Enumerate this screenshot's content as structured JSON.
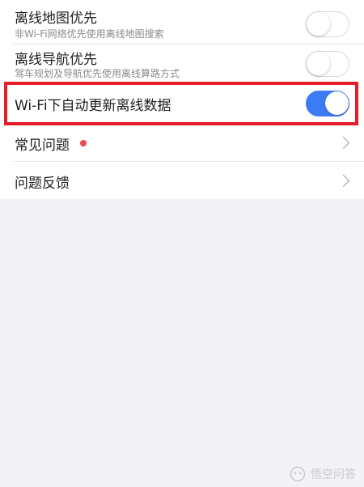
{
  "settings": {
    "offline_map": {
      "title": "离线地图优先",
      "subtitle": "非Wi-Fi网络优先使用离线地图搜索",
      "enabled": false
    },
    "offline_nav": {
      "title": "离线导航优先",
      "subtitle": "驾车规划及导航优先使用离线算路方式",
      "enabled": false
    },
    "wifi_update": {
      "title": "Wi-Fi下自动更新离线数据",
      "enabled": true
    },
    "faq": {
      "title": "常见问题"
    },
    "feedback": {
      "title": "问题反馈"
    }
  },
  "colors": {
    "accent": "#3b7cf5",
    "highlight": "#e41d27",
    "badge": "#f0494a",
    "background": "#f3f3f5"
  },
  "watermark": {
    "text": "悟空问答"
  }
}
